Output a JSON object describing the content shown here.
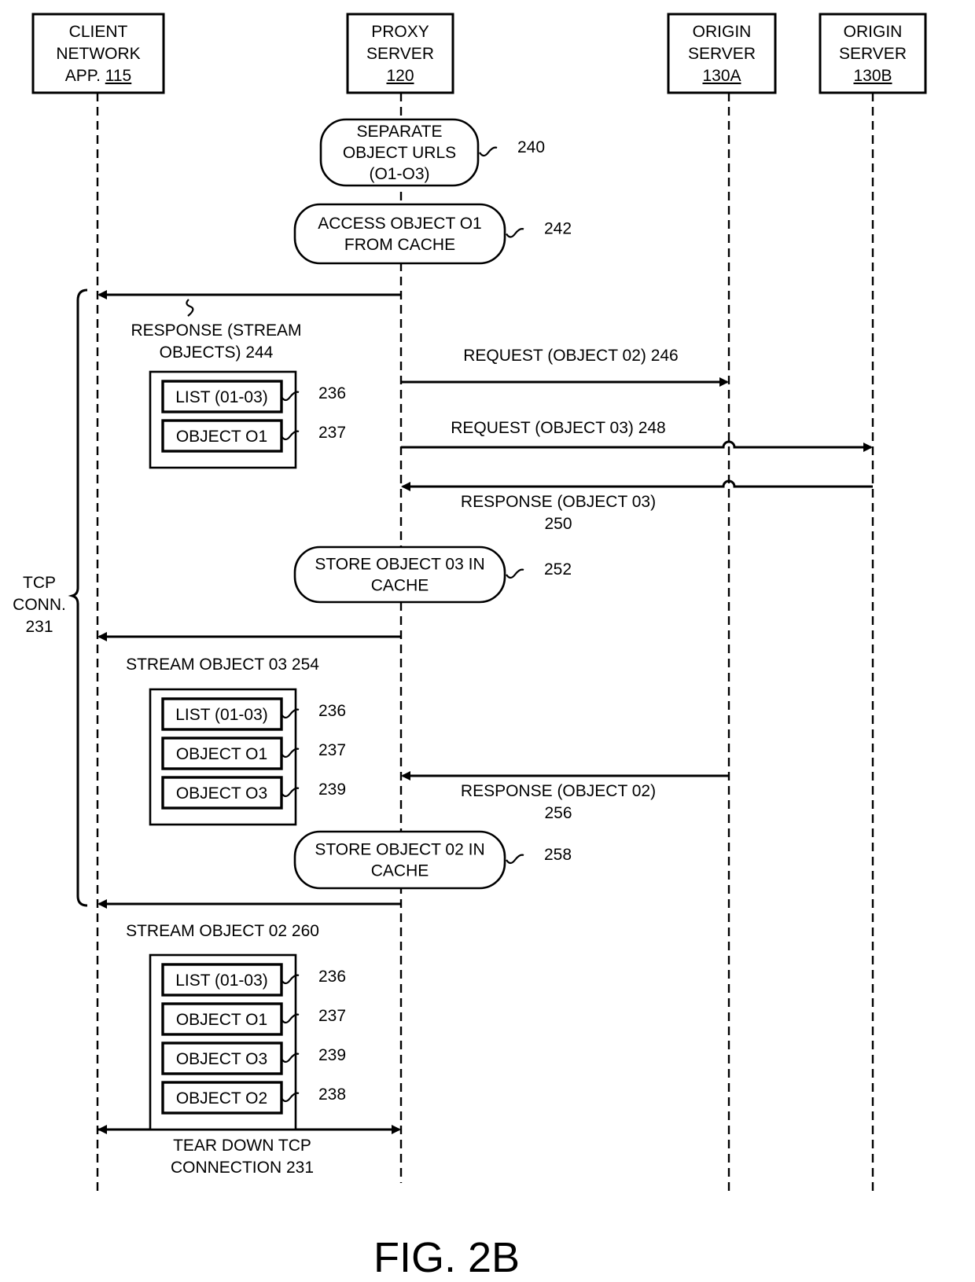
{
  "figure_label": "FIG. 2B",
  "colors": {
    "ink": "#000000",
    "background": "#ffffff"
  },
  "participants": [
    {
      "id": "client",
      "lines": [
        "CLIENT",
        "NETWORK"
      ],
      "last_prefix": "APP. ",
      "ref": "115"
    },
    {
      "id": "proxy",
      "lines": [
        "PROXY",
        "SERVER"
      ],
      "last_prefix": "",
      "ref": "120"
    },
    {
      "id": "origin_a",
      "lines": [
        "ORIGIN",
        "SERVER"
      ],
      "last_prefix": "",
      "ref": "130A"
    },
    {
      "id": "origin_b",
      "lines": [
        "ORIGIN",
        "SERVER"
      ],
      "last_prefix": "",
      "ref": "130B"
    }
  ],
  "process_steps": [
    {
      "id": "separate_urls",
      "lines": [
        "SEPARATE",
        "OBJECT URLS",
        "(O1-O3)"
      ],
      "ref": "240"
    },
    {
      "id": "access_o1",
      "lines": [
        "ACCESS OBJECT O1",
        "FROM CACHE"
      ],
      "ref": "242"
    },
    {
      "id": "store_o3",
      "lines": [
        "STORE OBJECT 03 IN",
        "CACHE"
      ],
      "ref": "252"
    },
    {
      "id": "store_o2",
      "lines": [
        "STORE OBJECT 02 IN",
        "CACHE"
      ],
      "ref": "258"
    }
  ],
  "messages": [
    {
      "id": "response_stream",
      "from": "proxy",
      "to": "client",
      "lines": [
        "RESPONSE (STREAM",
        "OBJECTS) 244"
      ]
    },
    {
      "id": "request_o2",
      "from": "proxy",
      "to": "origin_a",
      "lines": [
        "REQUEST (OBJECT 02) 246"
      ]
    },
    {
      "id": "request_o3",
      "from": "proxy",
      "to": "origin_b",
      "lines": [
        "REQUEST (OBJECT 03) 248"
      ]
    },
    {
      "id": "response_o3",
      "from": "origin_b",
      "to": "proxy",
      "lines": [
        "RESPONSE (OBJECT 03)",
        "250"
      ]
    },
    {
      "id": "stream_o3",
      "from": "proxy",
      "to": "client",
      "lines": [
        "STREAM OBJECT 03 254"
      ]
    },
    {
      "id": "response_o2",
      "from": "origin_a",
      "to": "proxy",
      "lines": [
        "RESPONSE (OBJECT 02)",
        "256"
      ]
    },
    {
      "id": "stream_o2",
      "from": "proxy",
      "to": "client",
      "lines": [
        "STREAM OBJECT 02 260"
      ]
    },
    {
      "id": "teardown",
      "from": "client",
      "to": "proxy",
      "lines": [
        "TEAR DOWN TCP",
        "CONNECTION  231"
      ]
    }
  ],
  "payload_groups": [
    {
      "id": "payload_244",
      "items": [
        {
          "label": "LIST (01-03)",
          "ref": "236"
        },
        {
          "label": "OBJECT O1",
          "ref": "237"
        }
      ]
    },
    {
      "id": "payload_254",
      "items": [
        {
          "label": "LIST (01-03)",
          "ref": "236"
        },
        {
          "label": "OBJECT O1",
          "ref": "237"
        },
        {
          "label": "OBJECT O3",
          "ref": "239"
        }
      ]
    },
    {
      "id": "payload_260",
      "items": [
        {
          "label": "LIST (01-03)",
          "ref": "236"
        },
        {
          "label": "OBJECT O1",
          "ref": "237"
        },
        {
          "label": "OBJECT O3",
          "ref": "239"
        },
        {
          "label": "OBJECT O2",
          "ref": "238"
        }
      ]
    }
  ],
  "tcp_bracket": {
    "lines": [
      "TCP",
      "CONN.",
      "231"
    ]
  }
}
